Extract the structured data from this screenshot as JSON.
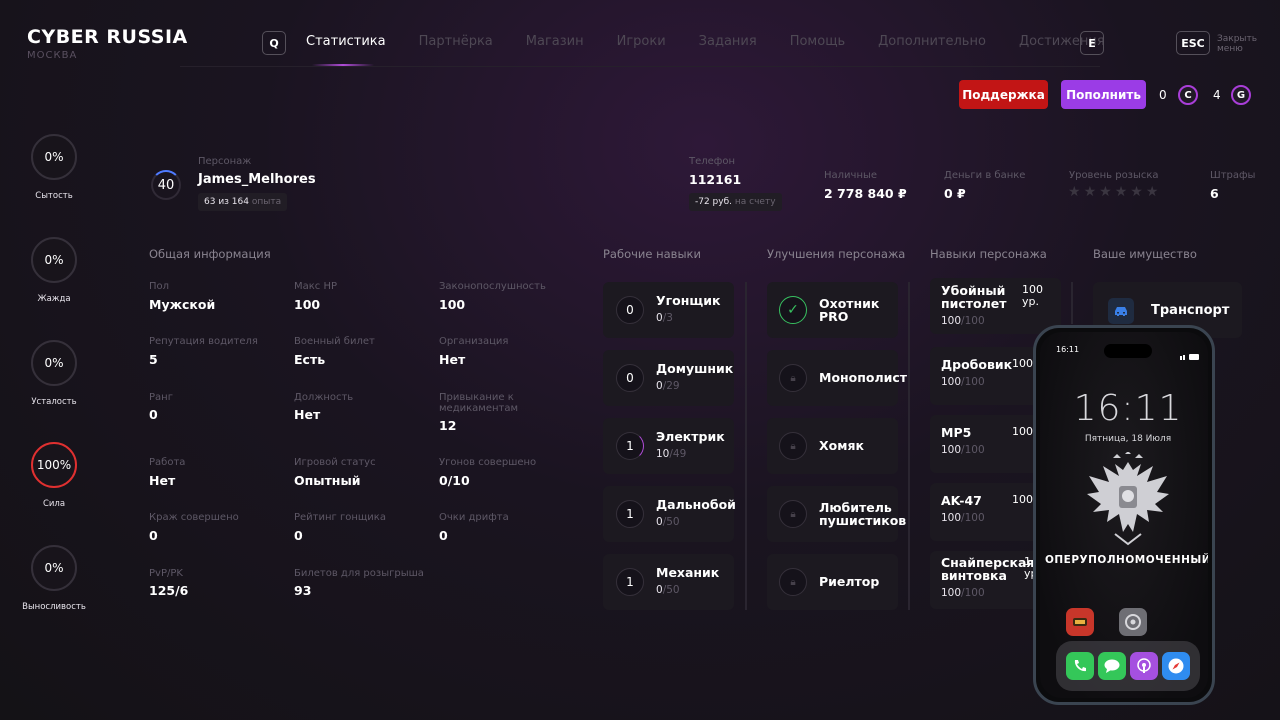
{
  "header": {
    "logo": "CYBER RUSSIA",
    "city": "МОСКВА",
    "key_left": "Q",
    "key_right": "E",
    "esc_key": "ESC",
    "esc_label": "Закрыть меню",
    "nav": [
      "Статистика",
      "Партнёрка",
      "Магазин",
      "Игроки",
      "Задания",
      "Помощь",
      "Дополнительно",
      "Достижения"
    ]
  },
  "actions": {
    "support": "Поддержка",
    "topup": "Пополнить",
    "coin_c_value": "0",
    "coin_c": "C",
    "coin_g_value": "4",
    "coin_g": "G"
  },
  "needs": [
    {
      "value": "0%",
      "label": "Сытость"
    },
    {
      "value": "0%",
      "label": "Жажда"
    },
    {
      "value": "0%",
      "label": "Усталость"
    },
    {
      "value": "100%",
      "label": "Сила"
    },
    {
      "value": "0%",
      "label": "Выносливость"
    }
  ],
  "profile": {
    "level": "40",
    "char_label": "Персонаж",
    "name": "James_Melhores",
    "exp": "63 из 164",
    "exp_suffix": "опыта",
    "phone_label": "Телефон",
    "phone": "112161",
    "phone_balance": "-72 руб.",
    "phone_balance_suffix": "на счету",
    "cash_label": "Наличные",
    "cash": "2 778 840 ₽",
    "bank_label": "Деньги в банке",
    "bank": "0 ₽",
    "wanted_label": "Уровень розыска",
    "wanted_level": 0,
    "wanted_max": 6,
    "fines_label": "Штрафы",
    "fines": "6"
  },
  "sections": {
    "general": "Общая информация",
    "work_skills": "Рабочие навыки",
    "upgrades": "Улучшения персонажа",
    "char_skills": "Навыки персонажа",
    "property": "Ваше имущество"
  },
  "info": [
    {
      "label": "Пол",
      "value": "Мужской"
    },
    {
      "label": "Макс HP",
      "value": "100"
    },
    {
      "label": "Законопослушность",
      "value": "100"
    },
    {
      "label": "Репутация водителя",
      "value": "5"
    },
    {
      "label": "Военный билет",
      "value": "Есть"
    },
    {
      "label": "Организация",
      "value": "Нет"
    },
    {
      "label": "Ранг",
      "value": "0"
    },
    {
      "label": "Должность",
      "value": "Нет"
    },
    {
      "label": "Привыкание к медикаментам",
      "value": "12"
    },
    {
      "label": "Работа",
      "value": "Нет"
    },
    {
      "label": "Игровой статус",
      "value": "Опытный"
    },
    {
      "label": "Угонов совершено",
      "value": "0/10"
    },
    {
      "label": "Краж совершено",
      "value": "0"
    },
    {
      "label": "Рейтинг гонщика",
      "value": "0"
    },
    {
      "label": "Очки дрифта",
      "value": "0"
    },
    {
      "label": "PvP/PK",
      "value": "125/6"
    },
    {
      "label": "Билетов для розыгрыша",
      "value": "93"
    }
  ],
  "work_skills": [
    {
      "level": "0",
      "name": "Угонщик",
      "progress": "0",
      "max": "/3"
    },
    {
      "level": "0",
      "name": "Домушник",
      "progress": "0",
      "max": "/29"
    },
    {
      "level": "1",
      "name": "Электрик",
      "progress": "10",
      "max": "/49"
    },
    {
      "level": "1",
      "name": "Дальнобой",
      "progress": "0",
      "max": "/50"
    },
    {
      "level": "1",
      "name": "Механик",
      "progress": "0",
      "max": "/50"
    }
  ],
  "upgrades": [
    {
      "name": "Охотник PRO",
      "unlocked": true
    },
    {
      "name": "Монополист",
      "unlocked": false
    },
    {
      "name": "Хомяк",
      "unlocked": false
    },
    {
      "name": "Любитель пушистиков",
      "unlocked": false
    },
    {
      "name": "Риелтор",
      "unlocked": false
    }
  ],
  "char_skills": [
    {
      "name": "Убойный пистолет",
      "value": "100",
      "max": "/100",
      "side": "100 ур."
    },
    {
      "name": "Дробовик",
      "value": "100",
      "max": "/100",
      "side": "100"
    },
    {
      "name": "MP5",
      "value": "100",
      "max": "/100",
      "side": "100"
    },
    {
      "name": "AK-47",
      "value": "100",
      "max": "/100",
      "side": "100"
    },
    {
      "name": "Снайперская винтовка",
      "value": "100",
      "max": "/100",
      "side": "1 ур"
    }
  ],
  "property": {
    "transport": "Транспорт"
  },
  "phone": {
    "status_time": "16:11",
    "clock": "16:11",
    "date": "Пятница, 18 Июля",
    "title": "ОПЕРУПОЛНОМОЧЕННЫЙ"
  }
}
